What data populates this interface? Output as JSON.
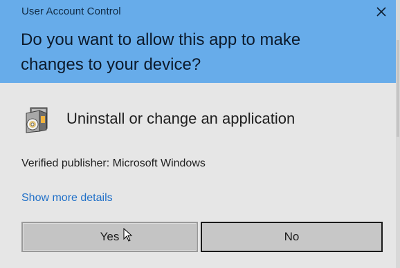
{
  "window": {
    "title": "User Account Control",
    "close_icon": "close-icon"
  },
  "prompt": {
    "question": "Do you want to allow this app to make changes to your device?"
  },
  "app": {
    "icon": "installer-cd-box-icon",
    "name": "Uninstall or change an application"
  },
  "details": {
    "publisher": "Verified publisher: Microsoft Windows",
    "more_link": "Show more details"
  },
  "buttons": {
    "yes": "Yes",
    "no": "No"
  },
  "colors": {
    "header_bg": "#67acea",
    "body_bg": "#e6e6e6",
    "link": "#2070c8",
    "button_bg": "#c4c4c4"
  }
}
